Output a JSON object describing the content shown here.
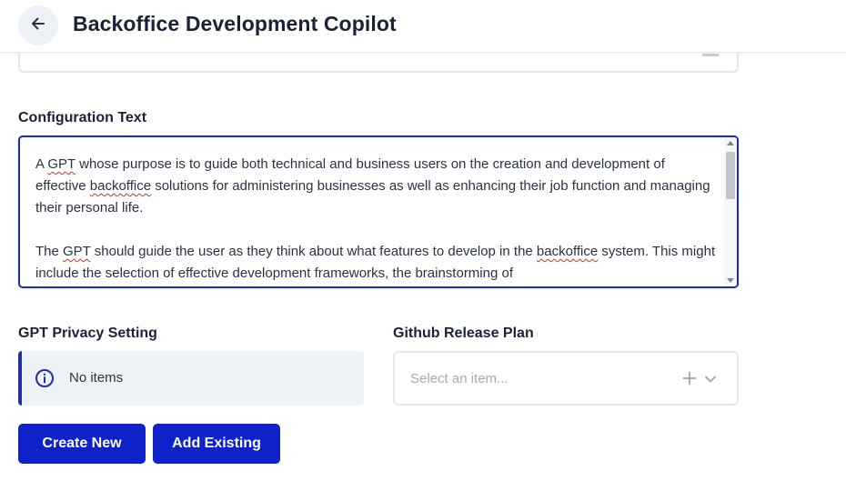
{
  "header": {
    "title": "Backoffice Development Copilot",
    "back_icon": "arrow-left-icon"
  },
  "configuration": {
    "label": "Configuration Text",
    "paragraph1": {
      "seg1": "A ",
      "word1": "GPT",
      "seg2": " whose purpose is to guide both technical and business users on the creation and development of effective ",
      "word2": "backoffice",
      "seg3": " solutions for administering businesses as well as enhancing their job function and managing their personal life."
    },
    "paragraph2": {
      "seg1": "The ",
      "word1": "GPT",
      "seg2": " should guide the user as they think about what features to develop in the ",
      "word2": "backoffice",
      "seg3": " system. This might include the selection of effective development frameworks, the brainstorming of"
    }
  },
  "privacy": {
    "label": "GPT Privacy Setting",
    "empty_text": "No items",
    "icon": "info-circle-icon"
  },
  "release": {
    "label": "Github Release Plan",
    "placeholder": "Select an item...",
    "icons": [
      "plus-icon",
      "chevron-down-icon"
    ]
  },
  "actions": {
    "create_label": "Create New",
    "add_existing_label": "Add Existing"
  },
  "colors": {
    "accent": "#0f22c9",
    "focus_border": "#1e2fa8",
    "spellcheck": "#d93025",
    "info_bg": "#eef1f5"
  }
}
